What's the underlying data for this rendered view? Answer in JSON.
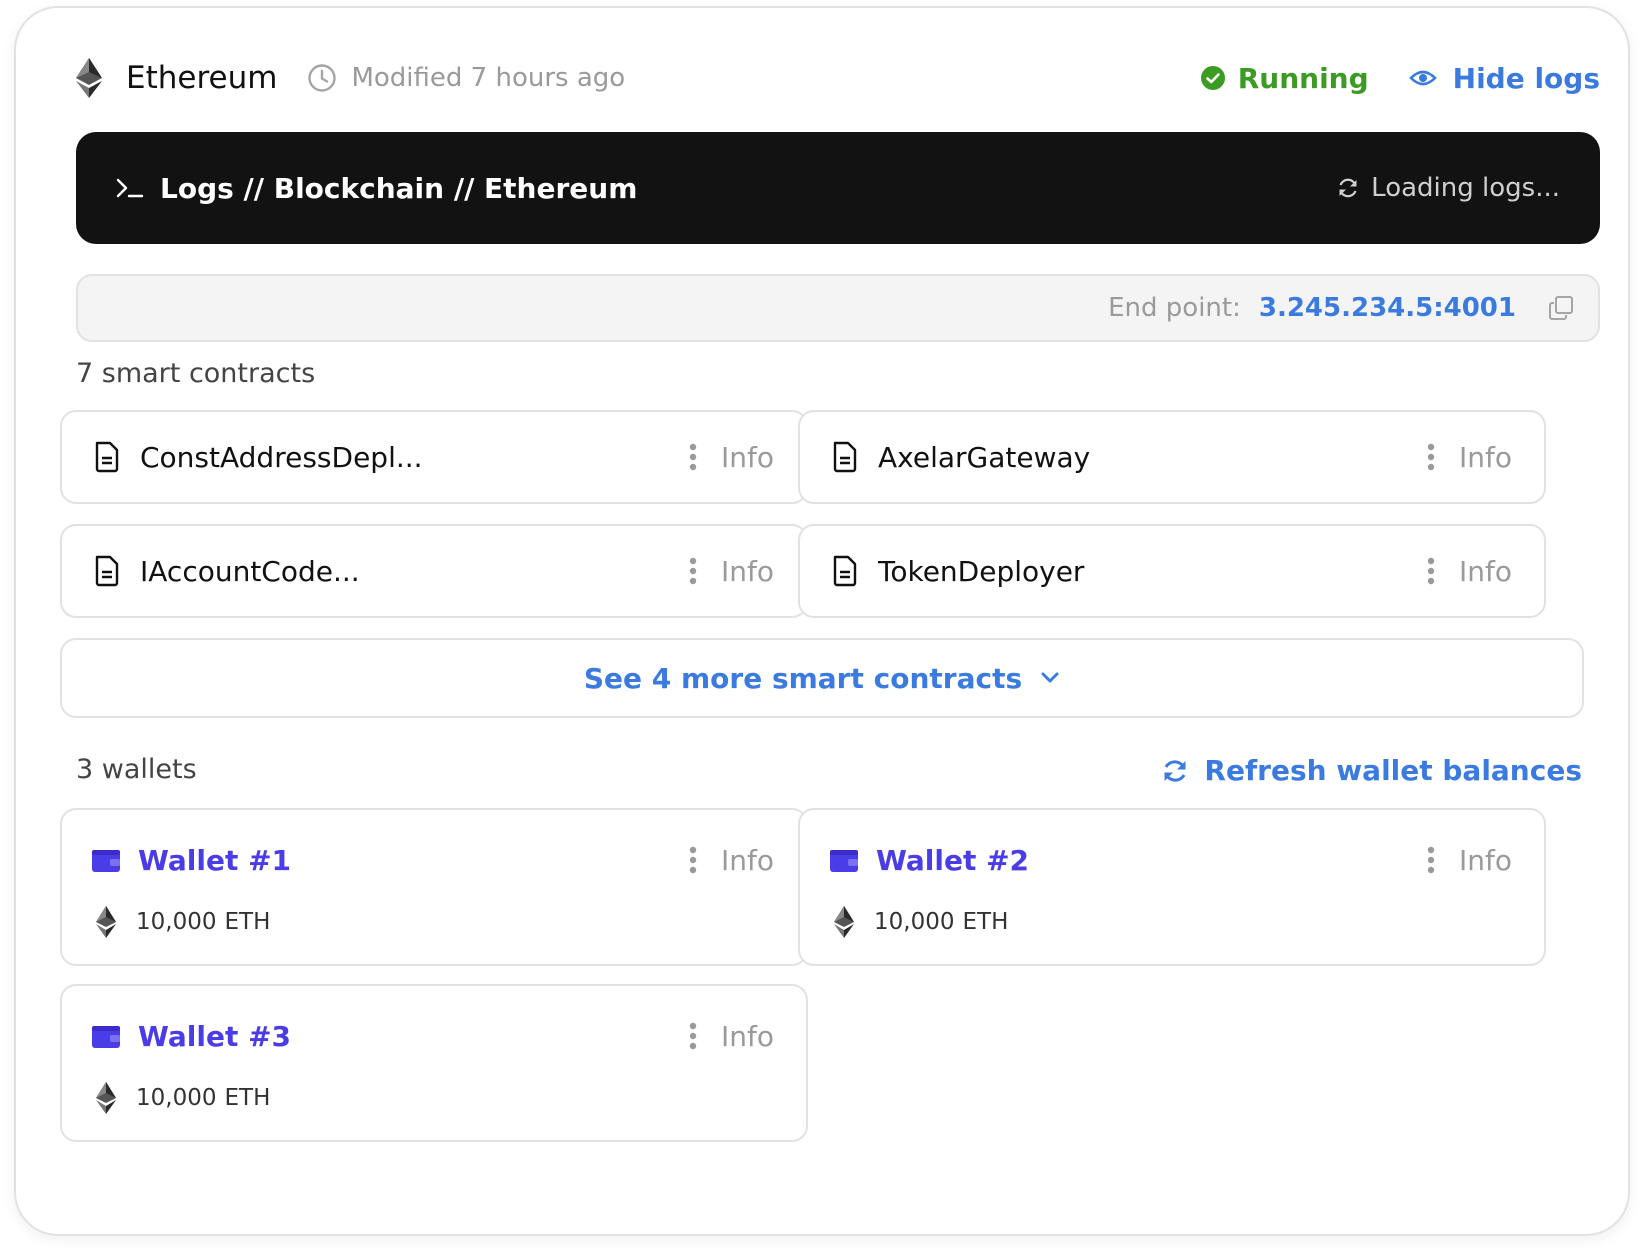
{
  "header": {
    "title": "Ethereum",
    "modified": "Modified 7 hours ago",
    "status": "Running",
    "status_color": "#3c9b23",
    "hide_logs": "Hide logs"
  },
  "logs": {
    "title": "Logs // Blockchain // Ethereum",
    "loading": "Loading logs..."
  },
  "endpoint": {
    "label": "End point:",
    "value": "3.245.234.5:4001"
  },
  "contracts": {
    "heading": "7 smart contracts",
    "items": [
      {
        "name": "ConstAddressDepl...",
        "action": "Info"
      },
      {
        "name": "AxelarGateway",
        "action": "Info"
      },
      {
        "name": "IAccountCode...",
        "action": "Info"
      },
      {
        "name": "TokenDeployer",
        "action": "Info"
      }
    ],
    "see_more": "See 4 more smart contracts"
  },
  "wallets": {
    "heading": "3 wallets",
    "refresh": "Refresh wallet balances",
    "items": [
      {
        "name": "Wallet #1",
        "amount": "10,000",
        "unit": "ETH",
        "action": "Info"
      },
      {
        "name": "Wallet #2",
        "amount": "10,000",
        "unit": "ETH",
        "action": "Info"
      },
      {
        "name": "Wallet #3",
        "amount": "10,000",
        "unit": "ETH",
        "action": "Info"
      }
    ]
  },
  "colors": {
    "accent": "#3b7be0",
    "wallet": "#4a3ce6",
    "logs_bg": "#121212"
  }
}
